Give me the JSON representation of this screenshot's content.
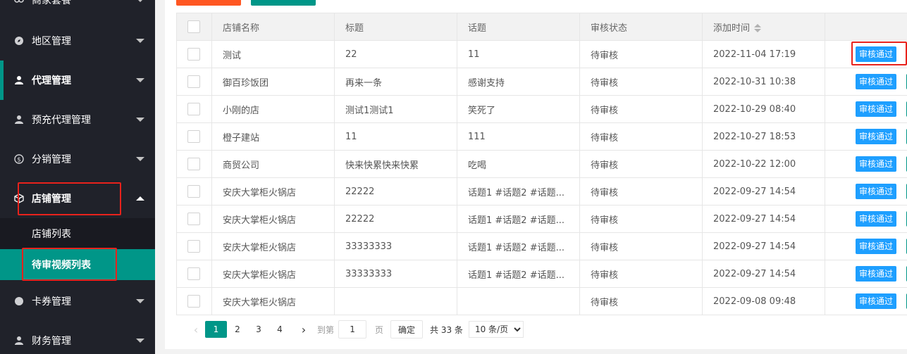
{
  "sidebar": {
    "items": [
      {
        "label": "商家套餐",
        "icon": "link-icon"
      },
      {
        "label": "地区管理",
        "icon": "compass-icon"
      },
      {
        "label": "代理管理",
        "icon": "user-icon"
      },
      {
        "label": "预充代理管理",
        "icon": "user-icon"
      },
      {
        "label": "分销管理",
        "icon": "dollar-icon"
      },
      {
        "label": "店铺管理",
        "icon": "cube-icon"
      },
      {
        "label": "卡券管理",
        "icon": "dot-icon"
      },
      {
        "label": "财务管理",
        "icon": "user-icon"
      }
    ],
    "sub_items": [
      {
        "label": "店铺列表"
      },
      {
        "label": "待审视频列表"
      }
    ]
  },
  "table": {
    "headers": [
      "店铺名称",
      "标题",
      "话题",
      "审核状态",
      "添加时间"
    ],
    "rows": [
      {
        "shop": "测试",
        "title": "22",
        "topic": "11",
        "status": "待审核",
        "time": "2022-11-04 17:19"
      },
      {
        "shop": "御百珍饭团",
        "title": "再来一条",
        "topic": "感谢支持",
        "status": "待审核",
        "time": "2022-10-31 10:38"
      },
      {
        "shop": "小刚的店",
        "title": "测试1测试1",
        "topic": "笑死了",
        "status": "待审核",
        "time": "2022-10-29 08:40"
      },
      {
        "shop": "橙子建站",
        "title": "11",
        "topic": "111",
        "status": "待审核",
        "time": "2022-10-27 18:53"
      },
      {
        "shop": "商贸公司",
        "title": "快来快累快来快累",
        "topic": "吃喝",
        "status": "待审核",
        "time": "2022-10-22 12:00"
      },
      {
        "shop": "安庆大掌柜火锅店",
        "title": "22222",
        "topic": "话题1 #话题2 #话题...",
        "status": "待审核",
        "time": "2022-09-27 14:54"
      },
      {
        "shop": "安庆大掌柜火锅店",
        "title": "22222",
        "topic": "话题1 #话题2 #话题...",
        "status": "待审核",
        "time": "2022-09-27 14:54"
      },
      {
        "shop": "安庆大掌柜火锅店",
        "title": "33333333",
        "topic": "话题1 #话题2 #话题...",
        "status": "待审核",
        "time": "2022-09-27 14:54"
      },
      {
        "shop": "安庆大掌柜火锅店",
        "title": "33333333",
        "topic": "话题1 #话题2 #话题...",
        "status": "待审核",
        "time": "2022-09-27 14:54"
      },
      {
        "shop": "安庆大掌柜火锅店",
        "title": "",
        "topic": "",
        "status": "待审核",
        "time": "2022-09-08 09:48"
      }
    ],
    "approve_label": "审核通过"
  },
  "pagination": {
    "prev": "‹",
    "next": "›",
    "pages": [
      "1",
      "2",
      "3",
      "4"
    ],
    "current": "1",
    "goto_label": "到第",
    "goto_value": "1",
    "page_unit": "页",
    "confirm_label": "确定",
    "total_text": "共 33 条",
    "page_size": "10 条/页"
  },
  "colors": {
    "accent": "#009688",
    "primary_button": "#1e9fff",
    "highlight_box": "#e8221c",
    "top_button_1": "#ff5722"
  }
}
